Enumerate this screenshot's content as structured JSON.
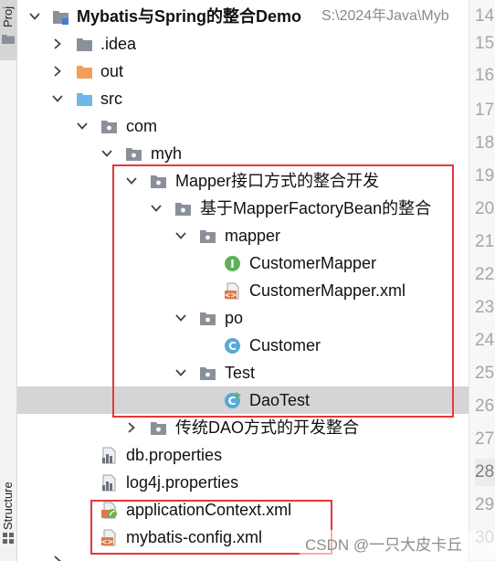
{
  "tool_window": {
    "project_tab_label": "Proj",
    "structure_tab_label": "Structure"
  },
  "project": {
    "name": "Mybatis与Spring的整合Demo",
    "path": "S:\\2024年Java\\Myb"
  },
  "tree": {
    "idea": ".idea",
    "out": "out",
    "src": "src",
    "com": "com",
    "myh": "myh",
    "mapper_interface_pkg": "Mapper接口方式的整合开发",
    "factory_bean_pkg": "基于MapperFactoryBean的整合",
    "mapper_pkg": "mapper",
    "customer_mapper": "CustomerMapper",
    "customer_mapper_xml": "CustomerMapper.xml",
    "po_pkg": "po",
    "customer": "Customer",
    "test_pkg": "Test",
    "dao_test": "DaoTest",
    "traditional_dao_pkg": "传统DAO方式的开发整合",
    "db_properties": "db.properties",
    "log4j_properties": "log4j.properties",
    "application_context": "applicationContext.xml",
    "mybatis_config": "mybatis-config.xml"
  },
  "line_numbers": [
    "14",
    "15",
    "16",
    "17",
    "18",
    "19",
    "20",
    "21",
    "22",
    "23",
    "24",
    "25",
    "26",
    "27",
    "28",
    "29",
    "30"
  ],
  "watermark": "CSDN @一只大皮卡丘",
  "colors": {
    "highlight_box": "#e8363a",
    "selected_row": "#d5d5d5",
    "folder_gray": "#8a9099",
    "folder_orange": "#f0a05a",
    "folder_blue": "#6fb7e6",
    "interface_green": "#5fb05a",
    "class_blue": "#56a9d8",
    "xml_orange": "#e07a4a"
  }
}
